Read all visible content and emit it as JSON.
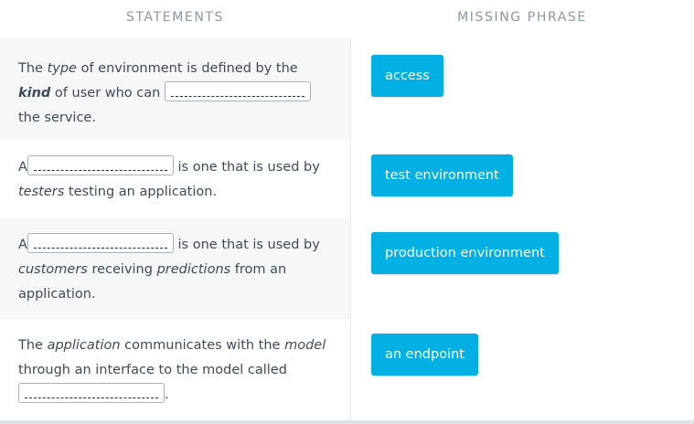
{
  "headers": {
    "statements": "STATEMENTS",
    "missing_phrase": "MISSING PHRASE"
  },
  "rows": [
    {
      "parts": [
        {
          "t": "The "
        },
        {
          "i": "type"
        },
        {
          "t": " of environment is defined by the"
        }
      ],
      "parts2": [
        {
          "bi": "kind"
        },
        {
          "t": " of user who can "
        }
      ],
      "parts3": [
        {
          "t": "the service."
        }
      ]
    },
    {
      "phrase": "access"
    }
  ],
  "statements": {
    "s1": {
      "a": "The ",
      "a_i": "type",
      "b": " of environment is defined by the",
      "c_bi": "kind",
      "d": " of user who can",
      "e": "the service."
    },
    "s2": {
      "a": "A",
      "b": "is one that is used by",
      "c_i": "testers",
      "d": " testing an application."
    },
    "s3": {
      "a": "A",
      "b": "is one that is used by",
      "c_i": "customers",
      "d": " receiving ",
      "e_i": "predictions",
      "f": " from an",
      "g": "application."
    },
    "s4": {
      "a": "The ",
      "a_i": "application",
      "b": " communicates with the ",
      "b_i": "model",
      "c": "through an interface to the model called",
      "d": "."
    }
  },
  "phrases": [
    "access",
    "test environment",
    "production environment",
    "an endpoint"
  ],
  "colors": {
    "chip": "#03b0e3",
    "shade": "#f5f7f9",
    "header_text": "#8a97a5"
  }
}
